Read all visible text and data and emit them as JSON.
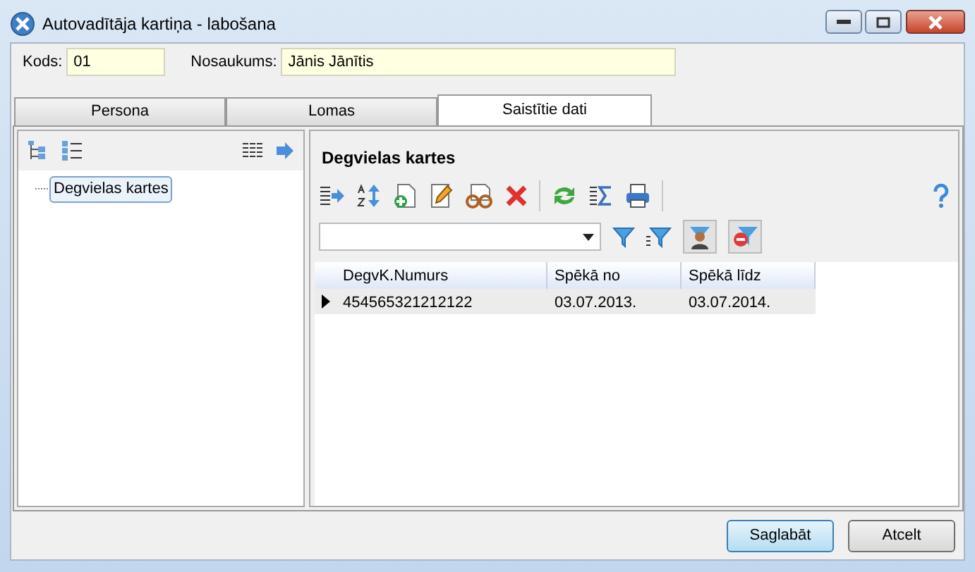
{
  "window": {
    "title": "Autovadītāja kartiņa - labošana"
  },
  "fields": [
    {
      "label": "Kods:",
      "value": "01"
    },
    {
      "label": "Nosaukums:",
      "value": "Jānis Jānītis"
    }
  ],
  "tabs": [
    {
      "label": "Persona",
      "selected": false
    },
    {
      "label": "Lomas",
      "selected": false
    },
    {
      "label": "Saistītie dati",
      "selected": true
    }
  ],
  "tree": {
    "items": [
      {
        "label": "Degvielas kartes",
        "selected": true
      }
    ]
  },
  "panel": {
    "title": "Degvielas kartes"
  },
  "table": {
    "columns": [
      "DegvK.Numurs",
      "Spēkā no",
      "Spēkā līdz"
    ],
    "rows": [
      {
        "cells": [
          "454565321212122",
          "03.07.2013.",
          "03.07.2014."
        ],
        "selected": true
      }
    ]
  },
  "buttons": [
    {
      "label": "Saglabāt",
      "default": true
    },
    {
      "label": "Atcelt",
      "default": false
    }
  ]
}
